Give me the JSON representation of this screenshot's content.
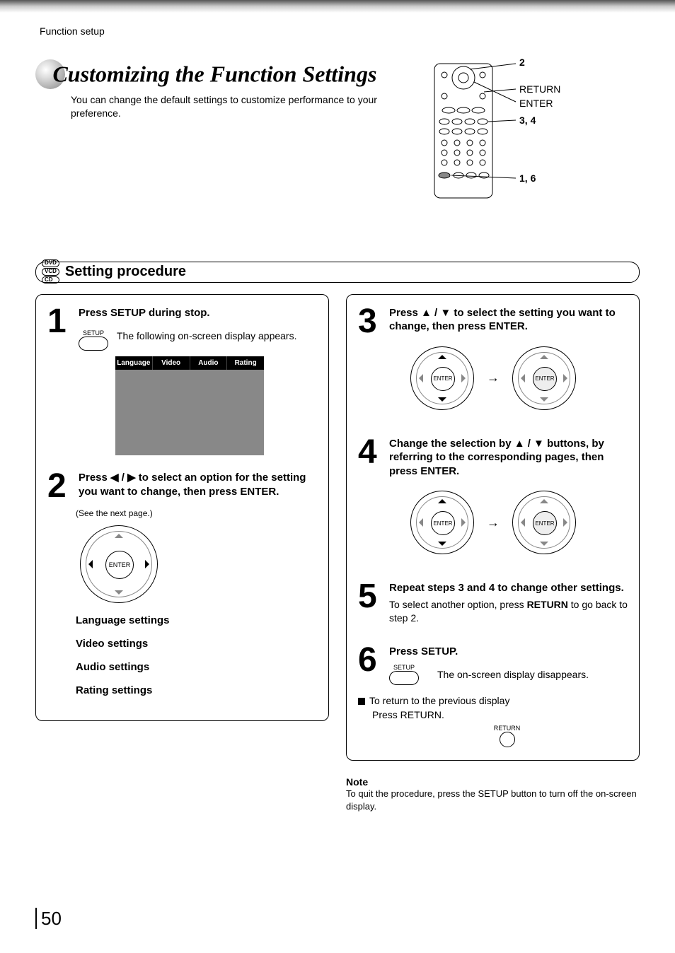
{
  "breadcrumb": "Function setup",
  "title": "Customizing the Function Settings",
  "subtitle": "You can change the default settings to customize performance to your preference.",
  "remote_callouts": {
    "c1": "2",
    "c2": "RETURN",
    "c3": "ENTER",
    "c4": "3, 4",
    "c5": "1, 6"
  },
  "disc_labels": [
    "DVD",
    "VCD",
    "CD"
  ],
  "section_title": "Setting procedure",
  "osd_tabs": [
    "Language",
    "Video",
    "Audio",
    "Rating"
  ],
  "step1": {
    "num": "1",
    "title": "Press SETUP during stop.",
    "btn": "SETUP",
    "body": "The following on-screen display appears."
  },
  "step2": {
    "num": "2",
    "title": "Press ◀ / ▶ to select an option for the setting you want to change, then press ENTER.",
    "seenext": "(See the next page.)",
    "enter": "ENTER",
    "settings": [
      "Language settings",
      "Video settings",
      "Audio settings",
      "Rating settings"
    ]
  },
  "step3": {
    "num": "3",
    "title": "Press ▲ / ▼ to select the setting you want to change, then press ENTER.",
    "enter": "ENTER"
  },
  "step4": {
    "num": "4",
    "title": "Change the selection by ▲ / ▼ buttons, by referring to the corresponding pages, then press ENTER.",
    "enter": "ENTER"
  },
  "step5": {
    "num": "5",
    "title": "Repeat steps 3 and 4 to change other settings.",
    "body_pre": "To select another option, press ",
    "body_bold": "RETURN",
    "body_post": " to go back to step 2."
  },
  "step6": {
    "num": "6",
    "title": "Press SETUP.",
    "btn": "SETUP",
    "body": "The on-screen display disappears."
  },
  "return_block": {
    "heading": "To return to the previous display",
    "body": "Press RETURN.",
    "btn": "RETURN"
  },
  "note": {
    "heading": "Note",
    "body": "To quit the procedure, press the SETUP button to turn off the on-screen display."
  },
  "page_number": "50"
}
